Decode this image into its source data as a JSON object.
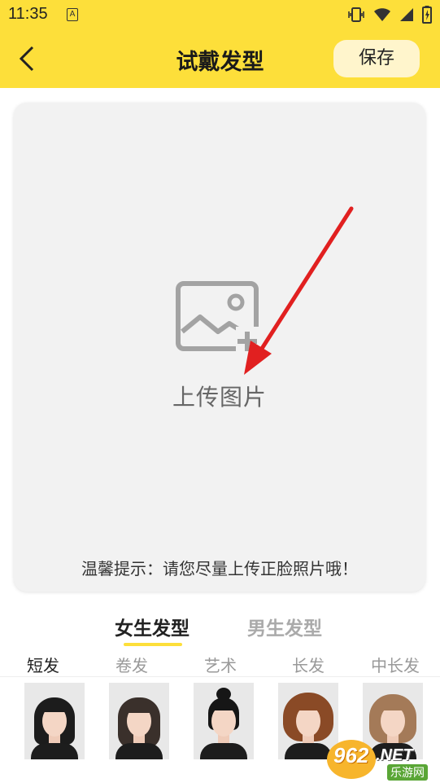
{
  "status_bar": {
    "time": "11:35",
    "notification_glyph": "A"
  },
  "header": {
    "title": "试戴发型",
    "save_label": "保存",
    "back_icon": "chevron-left-icon"
  },
  "upload": {
    "label": "上传图片",
    "icon": "image-add-icon",
    "tip": "温馨提示：请您尽量上传正脸照片哦！"
  },
  "gender_tabs": [
    {
      "label": "女生发型",
      "active": true
    },
    {
      "label": "男生发型",
      "active": false
    }
  ],
  "style_tabs": [
    {
      "label": "短发",
      "active": true
    },
    {
      "label": "卷发",
      "active": false
    },
    {
      "label": "艺术",
      "active": false
    },
    {
      "label": "长发",
      "active": false
    },
    {
      "label": "中长发",
      "active": false
    }
  ],
  "hairstyles": [
    {
      "name": "bob-hairstyle"
    },
    {
      "name": "wavy-bob-hairstyle"
    },
    {
      "name": "bun-hairstyle"
    },
    {
      "name": "curly-brown-hairstyle"
    },
    {
      "name": "light-brown-short-hairstyle"
    }
  ],
  "watermark": {
    "number": "962",
    "suffix": ".NET",
    "site": "乐游网"
  },
  "colors": {
    "accent": "#fddf3a",
    "save_bg": "#fff5cc",
    "card_bg": "#f2f2f2",
    "arrow": "#e12020"
  }
}
